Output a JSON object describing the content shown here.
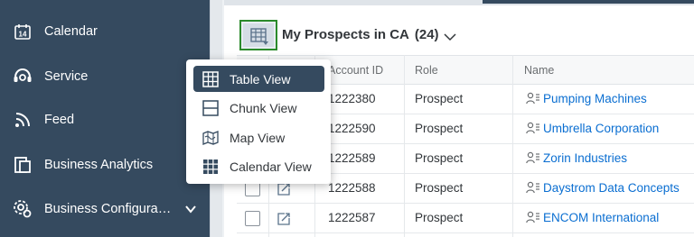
{
  "sidebar": {
    "items": [
      {
        "label": "Calendar",
        "icon": "calendar-icon",
        "icon_text": "14"
      },
      {
        "label": "Service",
        "icon": "service-icon"
      },
      {
        "label": "Feed",
        "icon": "feed-icon"
      },
      {
        "label": "Business Analytics",
        "icon": "analytics-icon"
      },
      {
        "label": "Business Configura…",
        "icon": "configuration-icon"
      }
    ]
  },
  "header": {
    "title": "My Prospects in CA",
    "count": "(24)"
  },
  "table": {
    "columns": {
      "account_id": "Account ID",
      "role": "Role",
      "name": "Name"
    },
    "rows": [
      {
        "account_id": "1222380",
        "role": "Prospect",
        "name": "Pumping Machines"
      },
      {
        "account_id": "1222590",
        "role": "Prospect",
        "name": "Umbrella Corporation"
      },
      {
        "account_id": "1222589",
        "role": "Prospect",
        "name": "Zorin Industries"
      },
      {
        "account_id": "1222588",
        "role": "Prospect",
        "name": "Daystrom Data Concepts"
      },
      {
        "account_id": "1222587",
        "role": "Prospect",
        "name": "ENCOM International"
      }
    ]
  },
  "view_menu": {
    "selected": "Table View",
    "items": [
      {
        "label": "Table View",
        "icon": "table-view-icon"
      },
      {
        "label": "Chunk View",
        "icon": "chunk-view-icon"
      },
      {
        "label": "Map View",
        "icon": "map-view-icon"
      },
      {
        "label": "Calendar View",
        "icon": "calendar-view-icon"
      }
    ]
  },
  "colors": {
    "sidebar_bg": "#354a5f",
    "link": "#0a6ed1",
    "focus_outline": "#2b8a2b",
    "selected_item_bg": "#354a5f"
  }
}
